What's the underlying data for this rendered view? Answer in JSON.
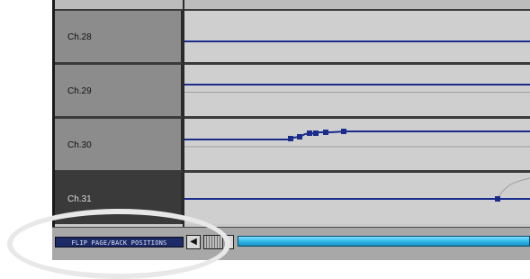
{
  "lanes": [
    {
      "label": "Ch.28",
      "dark": false
    },
    {
      "label": "Ch.29",
      "dark": false
    },
    {
      "label": "Ch.30",
      "dark": false
    },
    {
      "label": "Ch.31",
      "dark": true
    }
  ],
  "status_bar": {
    "flip_button_label": "FLIP PAGE/BACK POSITIONS",
    "scroll_left_glyph": "◀"
  },
  "colors": {
    "envelope": "#1a2d8c",
    "timeline": "#2fb6e8",
    "label_bg": "#8c8c8c",
    "label_bg_selected": "#3a3a3a"
  },
  "icons": {
    "scroll_left": "arrow-left-icon",
    "scroll_thumb": "scroll-thumb-grip",
    "highlight": "annotation-ellipse"
  }
}
